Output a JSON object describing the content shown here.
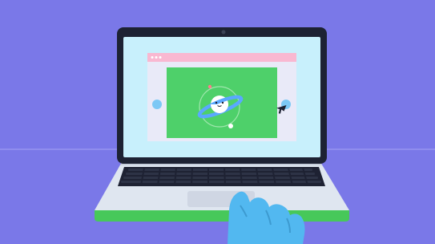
{
  "scene": {
    "subject": "laptop",
    "colors": {
      "background": "#7a78e8",
      "horizon_line": "#9593ee",
      "laptop_body": "#dfe6f0",
      "bezel": "#1d2233",
      "screen": "#c8f0fc",
      "browser_bar": "#f9b8d1",
      "browser_page": "#e9eaf8",
      "content_panel": "#4ed06a",
      "planet": "#ffffff",
      "planet_ring": "#5aa8ff",
      "nav_dot": "#7cc8f5",
      "trackpad": "#cfd6e3",
      "keys": "#1e2233",
      "base_stripe": "#49c95c",
      "hand": "#52b8f0"
    },
    "icons": [
      "planet-icon",
      "cursor-icon",
      "hand-icon"
    ]
  }
}
